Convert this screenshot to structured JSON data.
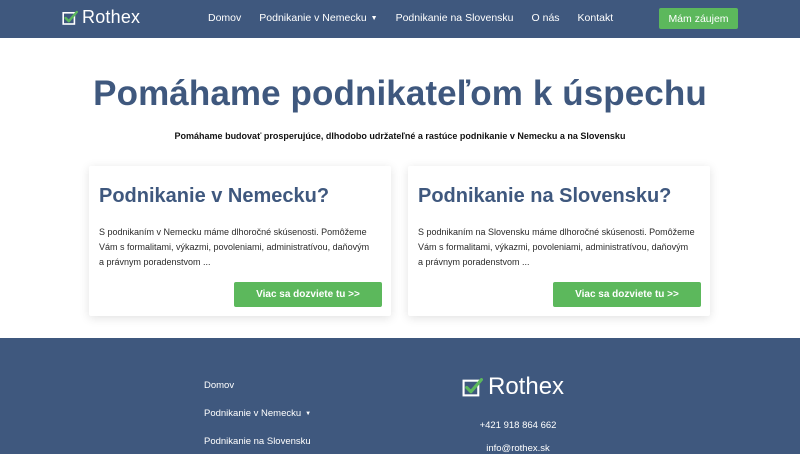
{
  "header": {
    "brand": "Rothex",
    "logo_icon": "checkbox-check-icon",
    "nav": [
      {
        "label": "Domov",
        "dropdown": false
      },
      {
        "label": "Podnikanie v Nemecku",
        "dropdown": true
      },
      {
        "label": "Podnikanie na Slovensku",
        "dropdown": false
      },
      {
        "label": "O nás",
        "dropdown": false
      },
      {
        "label": "Kontakt",
        "dropdown": false
      }
    ],
    "cta_label": "Mám záujem"
  },
  "hero": {
    "title": "Pomáhame podnikateľom k úspechu",
    "subtitle": "Pomáhame budovať prosperujúce, dlhodobo udržateľné a rastúce podnikanie v Nemecku a na Slovensku"
  },
  "cards": [
    {
      "title": "Podnikanie v Nemecku?",
      "lines": [
        "S podnikaním v Nemecku máme dlhoročné skúsenosti. Pomôžeme",
        "Vám s formalitami, výkazmi, povoleniami, administratívou, daňovým",
        "a právnym poradenstvom ..."
      ],
      "button": "Viac sa dozviete tu >>"
    },
    {
      "title": "Podnikanie na Slovensku?",
      "lines": [
        "S podnikaním na Slovensku máme dlhoročné skúsenosti. Pomôžeme",
        "Vám s formalitami, výkazmi, povoleniami, administratívou, daňovým",
        "a právnym poradenstvom ..."
      ],
      "button": "Viac sa dozviete tu >>"
    }
  ],
  "footer": {
    "nav": [
      "Domov",
      "Podnikanie v Nemecku",
      "Podnikanie na Slovensku"
    ],
    "brand": "Rothex",
    "phone": "+421 918 864 662",
    "email": "info@rothex.sk"
  },
  "colors": {
    "primary": "#3f587e",
    "accent": "#5cb85c",
    "background": "#ffffff"
  }
}
